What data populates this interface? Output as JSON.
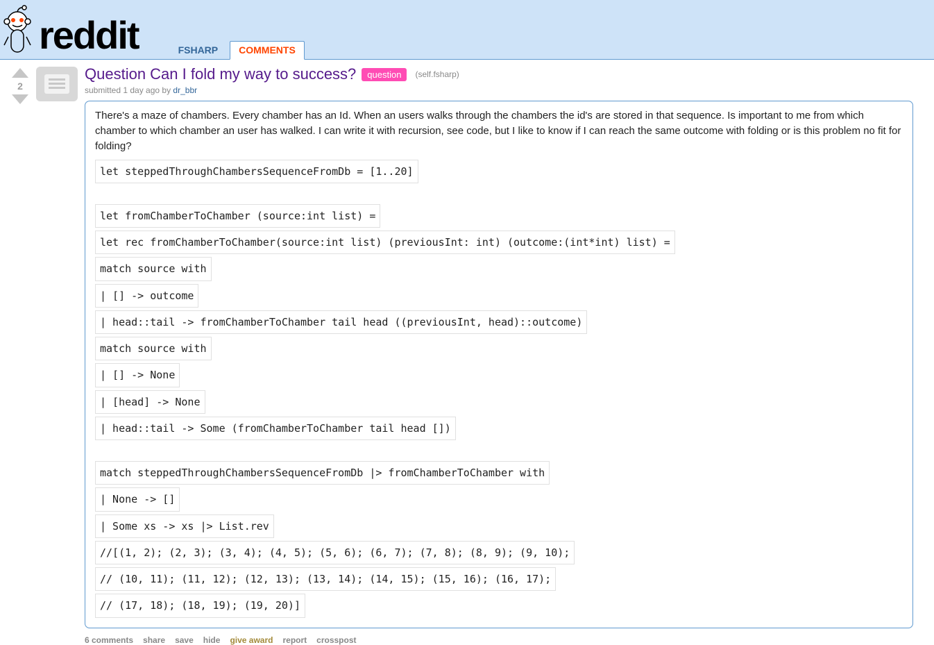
{
  "header": {
    "wordmark": "reddit",
    "tabs": [
      {
        "label": "fsharp",
        "active": false
      },
      {
        "label": "comments",
        "active": true
      }
    ]
  },
  "post": {
    "score": "2",
    "title": "Question Can I fold my way to success?",
    "flair": "question",
    "domain": "(self.fsharp)",
    "tagline_prefix": "submitted ",
    "time": "1 day ago",
    "by": " by ",
    "author": "dr_bbr",
    "body_text": "There's a maze of chambers. Every chamber has an Id. When an users walks through the chambers the id's are stored in that sequence. Is important to me from which chamber to which chamber an user has walked. I can write it with recursion, see code, but I like to know if I can reach the same outcome with folding or is this problem no fit for folding?",
    "code": [
      "let steppedThroughChambersSequenceFromDb = [1..20]",
      "",
      "let fromChamberToChamber (source:int list) =",
      "let rec fromChamberToChamber(source:int list) (previousInt: int) (outcome:(int*int) list) =",
      "match source with",
      "| [] -> outcome",
      "| head::tail -> fromChamberToChamber tail head ((previousInt, head)::outcome)",
      "match source with",
      "| [] -> None",
      "| [head] -> None",
      "| head::tail -> Some (fromChamberToChamber tail head [])",
      "",
      "match steppedThroughChambersSequenceFromDb |> fromChamberToChamber with",
      "| None -> []",
      "| Some xs -> xs |> List.rev",
      "//[(1, 2); (2, 3); (3, 4); (4, 5); (5, 6); (6, 7); (7, 8); (8, 9); (9, 10);",
      "// (10, 11); (11, 12); (12, 13); (13, 14); (14, 15); (15, 16); (16, 17);",
      "// (17, 18); (18, 19); (19, 20)]"
    ],
    "actions": {
      "comments": "6 comments",
      "share": "share",
      "save": "save",
      "hide": "hide",
      "award": "give award",
      "report": "report",
      "crosspost": "crosspost"
    }
  }
}
